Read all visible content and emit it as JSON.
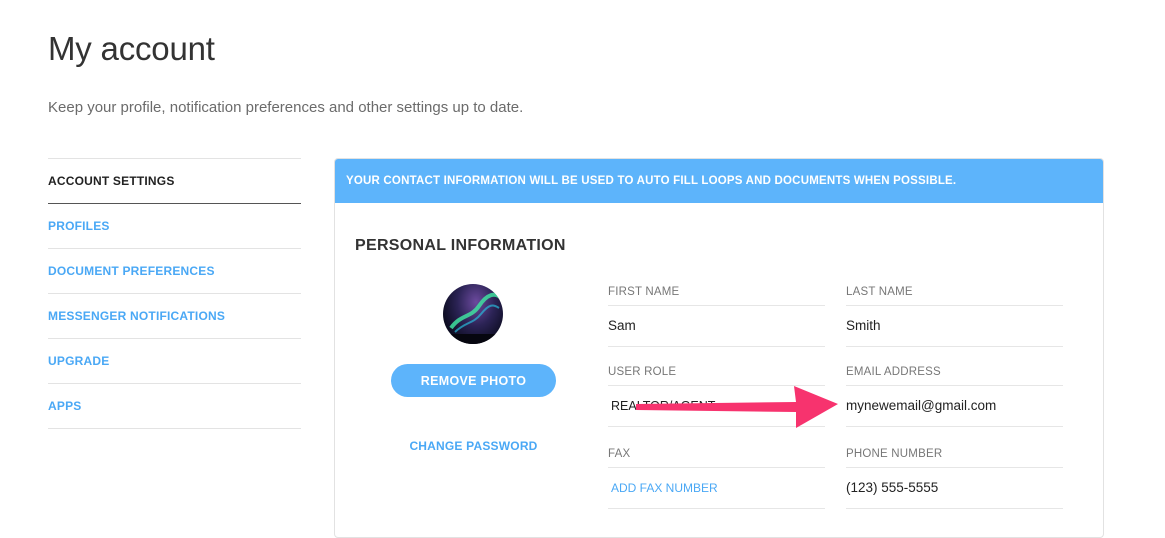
{
  "page": {
    "title": "My account",
    "subtitle": "Keep your profile, notification preferences and other settings up to date."
  },
  "sidebar": {
    "items": [
      {
        "label": "ACCOUNT SETTINGS",
        "active": true
      },
      {
        "label": "PROFILES"
      },
      {
        "label": "DOCUMENT PREFERENCES"
      },
      {
        "label": "MESSENGER NOTIFICATIONS"
      },
      {
        "label": "UPGRADE"
      },
      {
        "label": "APPS"
      }
    ]
  },
  "main": {
    "banner": "YOUR CONTACT INFORMATION WILL BE USED TO AUTO FILL LOOPS AND DOCUMENTS WHEN POSSIBLE.",
    "section_title": "PERSONAL INFORMATION",
    "remove_photo_label": "REMOVE PHOTO",
    "change_password_label": "CHANGE PASSWORD",
    "fields": {
      "first_name": {
        "label": "FIRST NAME",
        "value": "Sam"
      },
      "last_name": {
        "label": "LAST NAME",
        "value": "Smith"
      },
      "user_role": {
        "label": "USER ROLE",
        "value": "REALTOR/AGENT"
      },
      "email": {
        "label": "EMAIL ADDRESS",
        "value": "mynewemail@gmail.com"
      },
      "fax": {
        "label": "FAX",
        "value": "ADD FAX NUMBER"
      },
      "phone": {
        "label": "PHONE NUMBER",
        "value": "(123) 555-5555"
      }
    }
  },
  "colors": {
    "accent": "#5db4fb",
    "link": "#4aa8f5",
    "annotation_arrow": "#f7336e"
  }
}
